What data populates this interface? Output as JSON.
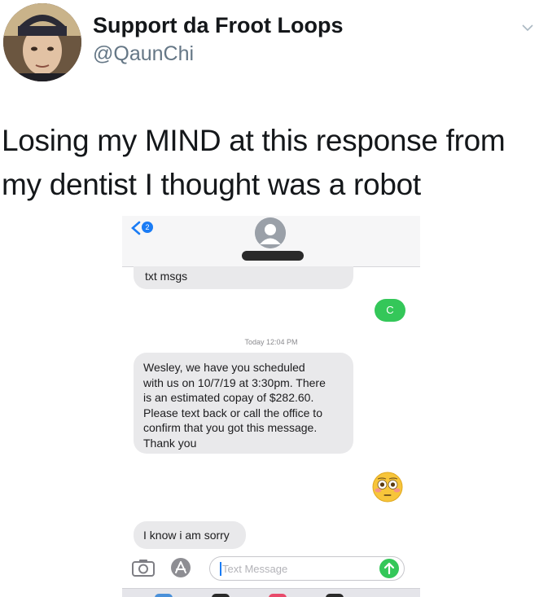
{
  "tweet": {
    "display_name": "Support da Froot Loops",
    "handle": "@QaunChi",
    "text_line_1": "Losing my MIND at this response from",
    "text_line_2": "my dentist I thought was a robot"
  },
  "icons": [
    "avatar",
    "chevron-down-icon",
    "back-chevron-icon",
    "contact-avatar-icon",
    "camera-icon",
    "app-store-icon",
    "send-arrow-icon",
    "flushed-face-emoji"
  ],
  "messages": {
    "back_badge": "2",
    "first_in": "txt msgs",
    "first_out": "C",
    "timestamp": "Today 12:04 PM",
    "dentist_lines": [
      "Wesley, we have you scheduled",
      "with us on 10/7/19 at 3:30pm. There",
      "is an estimated copay of $282.60.",
      "Please text back or call the office to",
      "confirm that you got this message.",
      "Thank you"
    ],
    "reply_in": "I know i am sorry"
  },
  "compose": {
    "placeholder": "Text Message"
  },
  "colors": {
    "imessage_green": "#34c759",
    "incoming_gray": "#e9e9eb",
    "link_blue": "#1a7cf5",
    "handle_gray": "#657786"
  }
}
